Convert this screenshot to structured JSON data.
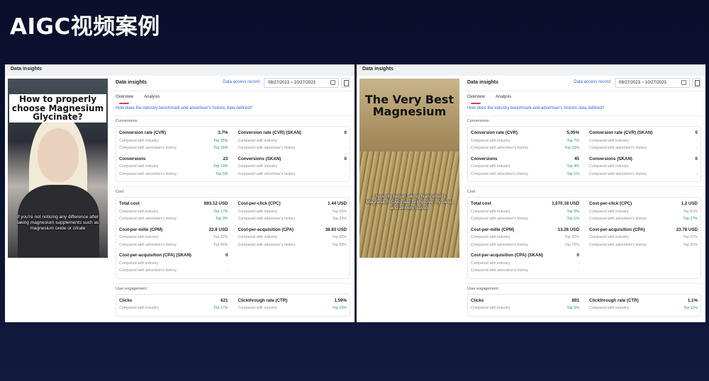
{
  "slide_title": "AIGC视频案例",
  "panels": [
    {
      "header": "Data insights",
      "video_title": "How to properly choose Magnesium Glycinate?",
      "video_caption": "If you're not noticing any difference after taking magnesium supplements such as magnesium oxide or citrate",
      "insights": {
        "title": "Data insights",
        "access_link": "Data access record",
        "date_range": "09/27/2023 ~ 10/27/2023",
        "tabs": [
          "Overview",
          "Analysis"
        ],
        "question": "How does the industry benchmark and advertiser's historic data defined?",
        "sections": [
          {
            "label": "Conversions",
            "metrics": [
              {
                "name": "Conversion rate (CVR)",
                "value": "3.7%",
                "industry": "Top 35%",
                "history": "Top 16%",
                "industry_green": true,
                "history_green": true
              },
              {
                "name": "Conversion rate (CVR) (SKAN)",
                "value": "0",
                "industry": "-",
                "history": "-",
                "industry_green": false,
                "history_green": false
              },
              {
                "name": "Conversions",
                "value": "23",
                "industry": "Top 19%",
                "history": "Top 5%",
                "industry_green": true,
                "history_green": true
              },
              {
                "name": "Conversions (SKAN)",
                "value": "0",
                "industry": "-",
                "history": "-",
                "industry_green": false,
                "history_green": false
              }
            ]
          },
          {
            "label": "Cost",
            "metrics": [
              {
                "name": "Total cost",
                "value": "893.12 USD",
                "industry": "Top 17%",
                "history": "Top 3%",
                "industry_green": true,
                "history_green": true
              },
              {
                "name": "Cost-per-click (CPC)",
                "value": "1.44 USD",
                "industry": "Top 55%",
                "history": "Top 32%",
                "industry_green": false,
                "history_green": false
              },
              {
                "name": "Cost-per-mille (CPM)",
                "value": "22.8 USD",
                "industry": "Top 92%",
                "history": "Top 86%",
                "industry_green": false,
                "history_green": false
              },
              {
                "name": "Cost-per-acquisition (CPA)",
                "value": "38.83 USD",
                "industry": "Top 82%",
                "history": "Top 98%",
                "industry_green": false,
                "history_green": false
              },
              {
                "name": "Cost-per-acquisition (CPA) (SKAN)",
                "value": "0",
                "industry": "-",
                "history": "-",
                "industry_green": false,
                "history_green": false
              }
            ]
          },
          {
            "label": "User engagement",
            "metrics": [
              {
                "name": "Clicks",
                "value": "621",
                "industry": "Top 17%",
                "history": "",
                "industry_green": true,
                "history_green": false
              },
              {
                "name": "Clickthrough rate (CTR)",
                "value": "1.59%",
                "industry": "Top 15%",
                "history": "",
                "industry_green": true,
                "history_green": false
              }
            ]
          }
        ]
      }
    },
    {
      "header": "Data insights",
      "video_title": "The Very Best Magnesium",
      "video_caption": "I recently began taking NatureBell's Magnesium Glycinate to improve my sleep and anxiety issues",
      "insights": {
        "title": "Data insights",
        "access_link": "Data access record",
        "date_range": "09/27/2023 ~ 10/27/2023",
        "tabs": [
          "Overview",
          "Analysis"
        ],
        "question": "How does the industry benchmark and advertiser's historic data defined?",
        "sections": [
          {
            "label": "Conversions",
            "metrics": [
              {
                "name": "Conversion rate (CVR)",
                "value": "5.05%",
                "industry": "Top 7%",
                "history": "Top 10%",
                "industry_green": true,
                "history_green": true
              },
              {
                "name": "Conversion rate (CVR) (SKAN)",
                "value": "0",
                "industry": "-",
                "history": "-",
                "industry_green": false,
                "history_green": false
              },
              {
                "name": "Conversions",
                "value": "45",
                "industry": "Top 4%",
                "history": "Top 1%",
                "industry_green": true,
                "history_green": true
              },
              {
                "name": "Conversions (SKAN)",
                "value": "0",
                "industry": "-",
                "history": "-",
                "industry_green": false,
                "history_green": false
              }
            ]
          },
          {
            "label": "Cost",
            "metrics": [
              {
                "name": "Total cost",
                "value": "1,070.18 USD",
                "industry": "Top 5%",
                "history": "Top 1%",
                "industry_green": true,
                "history_green": true
              },
              {
                "name": "Cost-per-click (CPC)",
                "value": "1.2 USD",
                "industry": "Top 81%",
                "history": "Top 27%",
                "industry_green": false,
                "history_green": true
              },
              {
                "name": "Cost-per-mille (CPM)",
                "value": "13.26 USD",
                "industry": "Top 92%",
                "history": "Top 76%",
                "industry_green": false,
                "history_green": false
              },
              {
                "name": "Cost-per-acquisition (CPA)",
                "value": "23.78 USD",
                "industry": "Top 97%",
                "history": "Top 91%",
                "industry_green": false,
                "history_green": false
              },
              {
                "name": "Cost-per-acquisition (CPA) (SKAN)",
                "value": "0",
                "industry": "-",
                "history": "-",
                "industry_green": false,
                "history_green": false
              }
            ]
          },
          {
            "label": "User engagement",
            "metrics": [
              {
                "name": "Clicks",
                "value": "891",
                "industry": "Top 5%",
                "history": "",
                "industry_green": true,
                "history_green": false
              },
              {
                "name": "Clickthrough rate (CTR)",
                "value": "1.1%",
                "industry": "Top 11%",
                "history": "",
                "industry_green": true,
                "history_green": false
              }
            ]
          }
        ]
      }
    }
  ],
  "labels": {
    "compared_industry": "Compared with industry",
    "compared_history": "Compared with advertiser's history"
  },
  "colors": {
    "accent_link": "#2e63d9",
    "tab_underline": "#e2375a",
    "positive": "#1f9d57"
  }
}
